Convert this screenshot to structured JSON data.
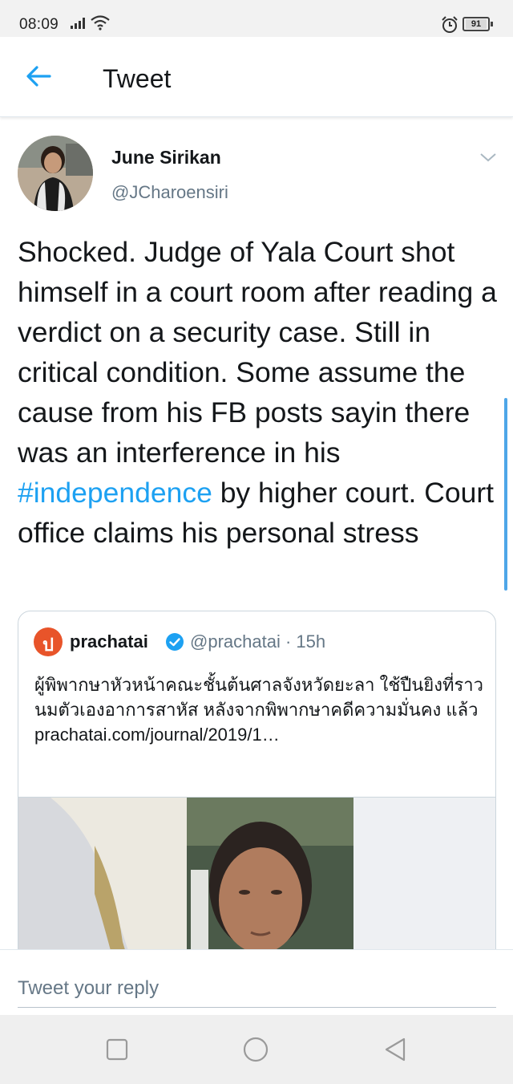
{
  "status_bar": {
    "time": "08:09",
    "battery": "91",
    "icons": [
      "signal-icon",
      "wifi-icon",
      "alarm-icon",
      "battery-icon"
    ]
  },
  "header": {
    "title": "Tweet",
    "back_icon": "back-arrow-icon"
  },
  "tweet": {
    "author_name": "June Sirikan",
    "author_handle": "@JCharoensiri",
    "text_before_hashtag": "Shocked. Judge of Yala Court shot himself in a court room after reading a verdict on a security case. Still in critical condition. Some assume the cause from his FB posts sayin there was an interference in his ",
    "hashtag": "#independence",
    "text_after_hashtag": " by higher court. Court office claims his personal stress",
    "caret_icon": "chevron-down-icon"
  },
  "quote": {
    "logo_letter": "ป",
    "name": "prachatai",
    "handle_time": "@prachatai · 15h",
    "text": "ผู้พิพากษาหัวหน้าคณะชั้นต้นศาลจังหวัดยะลา ใช้ปืนยิงที่ราวนมตัวเองอาการสาหัส หลังจากพิพากษาคดีความมั่นคง แล้ว",
    "link": "prachatai.com/journal/2019/1…"
  },
  "reply": {
    "placeholder": "Tweet your reply"
  },
  "colors": {
    "accent": "#1da1f2",
    "text": "#14171a",
    "secondary": "#657786",
    "border": "#ccd6dd"
  }
}
